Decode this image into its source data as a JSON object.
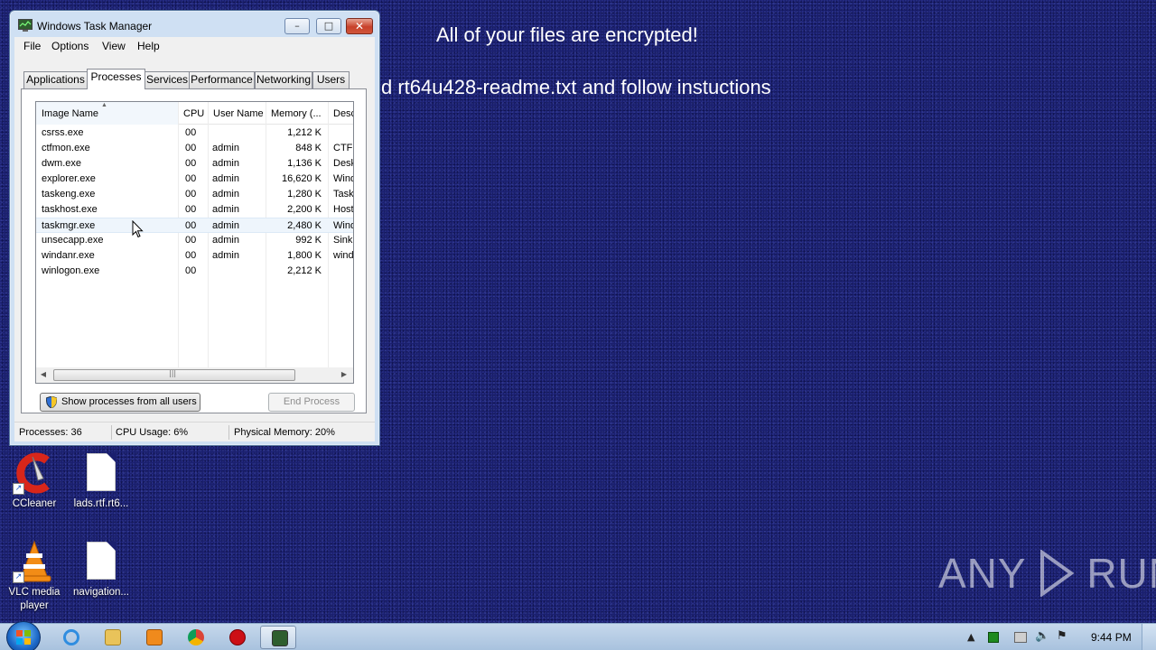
{
  "ransom": {
    "line1": "All of your files are encrypted!",
    "line2": "d rt64u428-readme.txt and follow instuctions"
  },
  "window": {
    "title": "Windows Task Manager",
    "controls": {
      "minimize": "–",
      "maximize": "□",
      "close": "✕"
    },
    "menu": [
      "File",
      "Options",
      "View",
      "Help"
    ],
    "tabs": [
      {
        "label": "Applications",
        "active": false
      },
      {
        "label": "Processes",
        "active": true
      },
      {
        "label": "Services",
        "active": false
      },
      {
        "label": "Performance",
        "active": false
      },
      {
        "label": "Networking",
        "active": false
      },
      {
        "label": "Users",
        "active": false
      }
    ],
    "columns": [
      "Image Name",
      "CPU",
      "User Name",
      "Memory (...",
      "Desc"
    ],
    "processes": [
      {
        "name": "csrss.exe",
        "cpu": "00",
        "user": "",
        "memory": "1,212 K",
        "desc": ""
      },
      {
        "name": "ctfmon.exe",
        "cpu": "00",
        "user": "admin",
        "memory": "848 K",
        "desc": "CTF"
      },
      {
        "name": "dwm.exe",
        "cpu": "00",
        "user": "admin",
        "memory": "1,136 K",
        "desc": "Desk"
      },
      {
        "name": "explorer.exe",
        "cpu": "00",
        "user": "admin",
        "memory": "16,620 K",
        "desc": "Wind"
      },
      {
        "name": "taskeng.exe",
        "cpu": "00",
        "user": "admin",
        "memory": "1,280 K",
        "desc": "Task"
      },
      {
        "name": "taskhost.exe",
        "cpu": "00",
        "user": "admin",
        "memory": "2,200 K",
        "desc": "Host"
      },
      {
        "name": "taskmgr.exe",
        "cpu": "00",
        "user": "admin",
        "memory": "2,480 K",
        "desc": "Wind"
      },
      {
        "name": "unsecapp.exe",
        "cpu": "00",
        "user": "admin",
        "memory": "992 K",
        "desc": "Sink"
      },
      {
        "name": "windanr.exe",
        "cpu": "00",
        "user": "admin",
        "memory": "1,800 K",
        "desc": "wind"
      },
      {
        "name": "winlogon.exe",
        "cpu": "00",
        "user": "",
        "memory": "2,212 K",
        "desc": ""
      }
    ],
    "hover_row": 6,
    "buttons": {
      "show_all": "Show processes from all users",
      "end_process": "End Process"
    },
    "status": {
      "processes": "Processes: 36",
      "cpu": "CPU Usage: 6%",
      "memory": "Physical Memory: 20%"
    }
  },
  "desktop_icons": [
    {
      "label": "CCleaner",
      "icon": "ccleaner-icon"
    },
    {
      "label": "lads.rtf.rt6...",
      "icon": "document-icon"
    },
    {
      "label": "VLC media player",
      "icon": "vlc-icon"
    },
    {
      "label": "navigation...",
      "icon": "document-icon"
    }
  ],
  "watermark": {
    "left": "ANY",
    "right": "RUN"
  },
  "taskbar": {
    "pinned": [
      "internet-explorer-icon",
      "folder-icon",
      "media-player-icon",
      "chrome-icon",
      "opera-icon",
      "task-manager-icon"
    ],
    "tray": {
      "clock": "9:44 PM"
    }
  },
  "colors": {
    "desktop": "#1a1f6e",
    "close_button": "#c8412a",
    "selection": "#eef5fc"
  }
}
